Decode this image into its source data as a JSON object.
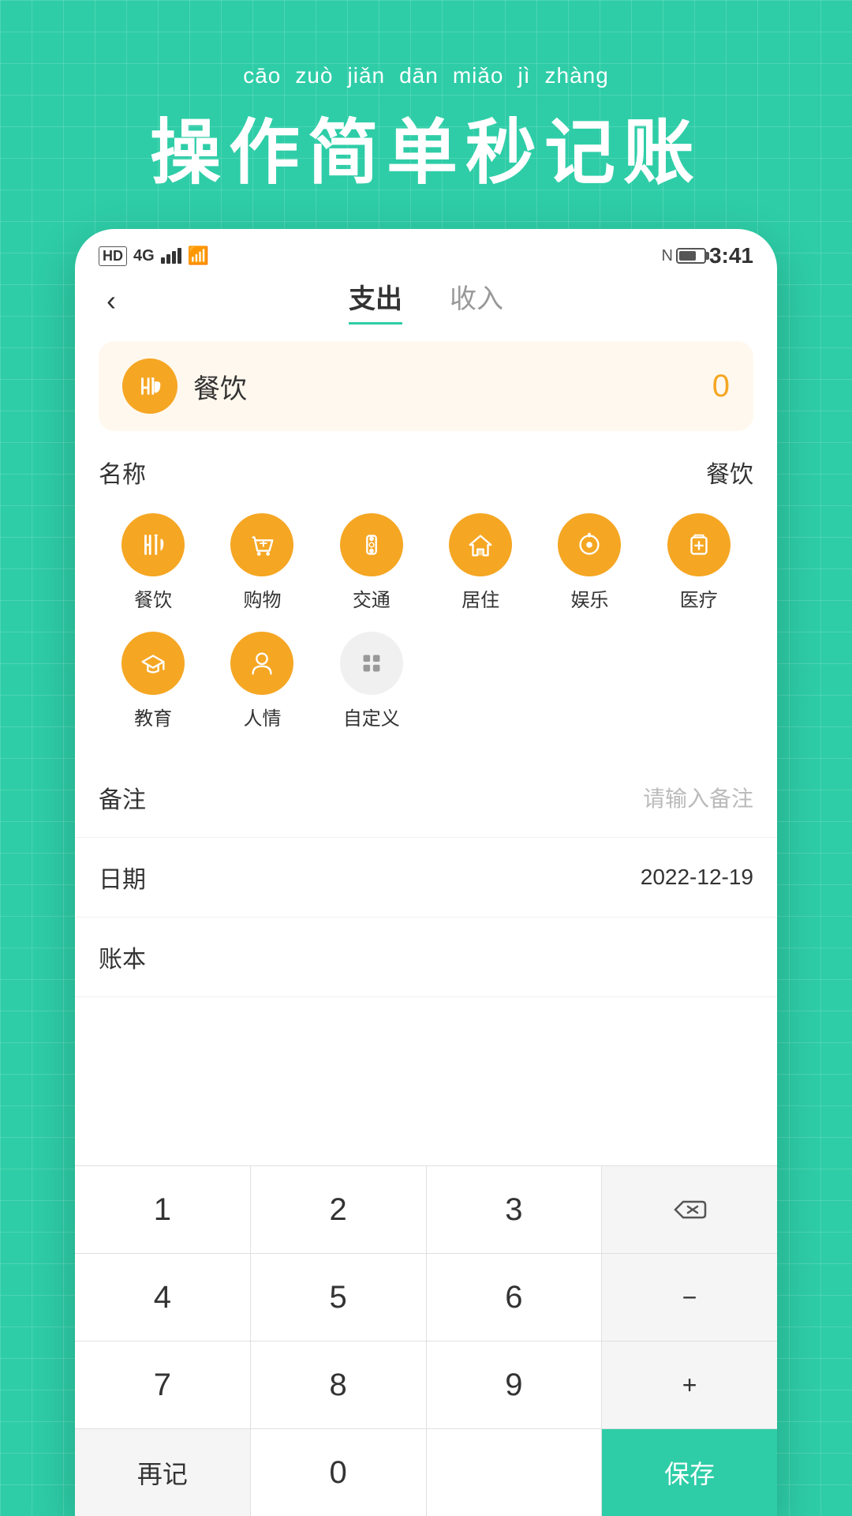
{
  "background": {
    "color": "#2ECDA7"
  },
  "header": {
    "pinyin": [
      "cāo",
      "zuò",
      "jiǎn",
      "dān",
      "miǎo",
      "jì",
      "zhàng"
    ],
    "chinese": "操作简单秒记账"
  },
  "statusBar": {
    "time": "3:41",
    "signal": "4G"
  },
  "tabs": {
    "expense": "支出",
    "income": "收入",
    "active": "expense"
  },
  "amountDisplay": {
    "icon": "fork-knife",
    "label": "餐饮",
    "value": "0"
  },
  "categorySection": {
    "label": "名称",
    "selectedValue": "餐饮",
    "categories": [
      {
        "id": "food",
        "name": "餐饮",
        "icon": "fork-knife"
      },
      {
        "id": "shopping",
        "name": "购物",
        "icon": "cart"
      },
      {
        "id": "transport",
        "name": "交通",
        "icon": "traffic"
      },
      {
        "id": "housing",
        "name": "居住",
        "icon": "house"
      },
      {
        "id": "entertainment",
        "name": "娱乐",
        "icon": "entertainment"
      },
      {
        "id": "medical",
        "name": "医疗",
        "icon": "medical"
      },
      {
        "id": "education",
        "name": "教育",
        "icon": "education"
      },
      {
        "id": "social",
        "name": "人情",
        "icon": "person"
      },
      {
        "id": "custom",
        "name": "自定义",
        "icon": "custom",
        "gray": true
      }
    ]
  },
  "remarksRow": {
    "label": "备注",
    "placeholder": "请输入备注"
  },
  "dateRow": {
    "label": "日期",
    "value": "2022-12-19"
  },
  "accountRow": {
    "label": "账本"
  },
  "keyboard": {
    "rows": [
      [
        "1",
        "2",
        "3",
        "⌫"
      ],
      [
        "4",
        "5",
        "6",
        "−"
      ],
      [
        "7",
        "8",
        "9",
        "+"
      ],
      [
        "再记",
        "0",
        "",
        "保存"
      ]
    ],
    "saveLabel": "保存",
    "reRecordLabel": "再记",
    "deleteLabel": "⌫"
  }
}
